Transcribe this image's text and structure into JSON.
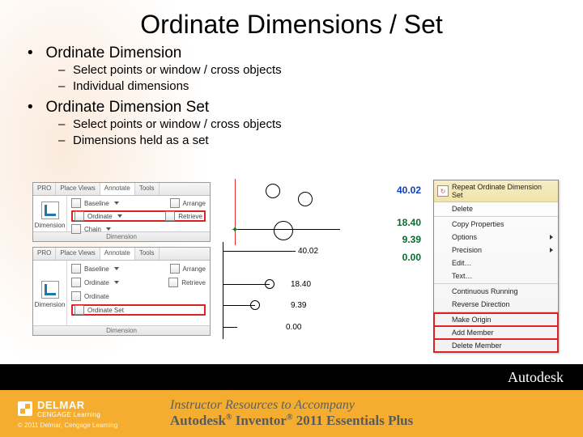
{
  "title": "Ordinate Dimensions / Set",
  "bullets": {
    "b1": "Ordinate Dimension",
    "b1_subs": [
      "Select points or window / cross objects",
      "Individual dimensions"
    ],
    "b2": "Ordinate Dimension Set",
    "b2_subs": [
      "Select points or window / cross objects",
      "Dimensions held as a set"
    ]
  },
  "ribbon": {
    "tabs": [
      "PRO",
      "Place Views",
      "Annotate",
      "Tools"
    ],
    "active_tab": "Annotate",
    "big_button": "Dimension",
    "rows": {
      "baseline": "Baseline",
      "ordinate": "Ordinate",
      "chain": "Chain",
      "arrange": "Arrange",
      "retrieve": "Retrieve",
      "ordinate_set": "Ordinate Set"
    },
    "footer": "Dimension"
  },
  "ordinate_values": [
    "40.02",
    "18.40",
    "9.39",
    "0.00"
  ],
  "right_numbers": {
    "top": "40.02",
    "mid1": "18.40",
    "mid2": "9.39",
    "bot": "0.00"
  },
  "context_menu": {
    "header": "Repeat Ordinate Dimension Set",
    "delete": "Delete",
    "copy_props": "Copy Properties",
    "options": "Options",
    "precision": "Precision",
    "edit": "Edit…",
    "text": "Text…",
    "cont_running": "Continuous Running",
    "reverse": "Reverse Direction",
    "make_origin": "Make Origin",
    "add_member": "Add Member",
    "delete_member": "Delete Member"
  },
  "footer_brand": "Autodesk",
  "delmar": {
    "name": "DELMAR",
    "sub": "CENGAGE Learning",
    "copy": "© 2011 Delmar, Cengage Learning"
  },
  "ftext": {
    "l1": "Instructor Resources to Accompany",
    "l2a": "Autodesk",
    "l2b": " Inventor",
    "l2c": " 2011",
    "l2d": " Essentials Plus"
  }
}
